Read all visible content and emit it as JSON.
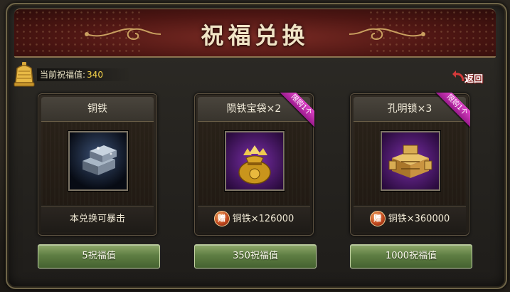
{
  "window": {
    "title": "祝福兑换",
    "return_label": "返回"
  },
  "bless": {
    "label": "当前祝福值:",
    "value": "340"
  },
  "cards": [
    {
      "name": "铜铁",
      "item_icon": "bronze-iron-ingot-icon",
      "limit_badge": "",
      "foot_text": "本兑换可暴击",
      "foot_gift_badge": "",
      "button_label": "5祝福值"
    },
    {
      "name": "陨铁宝袋×2",
      "item_icon": "meteor-iron-bag-icon",
      "limit_badge": "限购1个",
      "foot_text": "铜铁×126000",
      "foot_gift_badge": "赠",
      "button_label": "350祝福值"
    },
    {
      "name": "孔明锁×3",
      "item_icon": "kongming-lock-icon",
      "limit_badge": "限购1个",
      "foot_text": "铜铁×360000",
      "foot_gift_badge": "赠",
      "button_label": "1000祝福值"
    }
  ],
  "colors": {
    "banner_red": "#4e1613",
    "bless_value": "#f7d44a",
    "button_green": "#5f7e43",
    "ribbon_magenta": "#c22fb0"
  }
}
